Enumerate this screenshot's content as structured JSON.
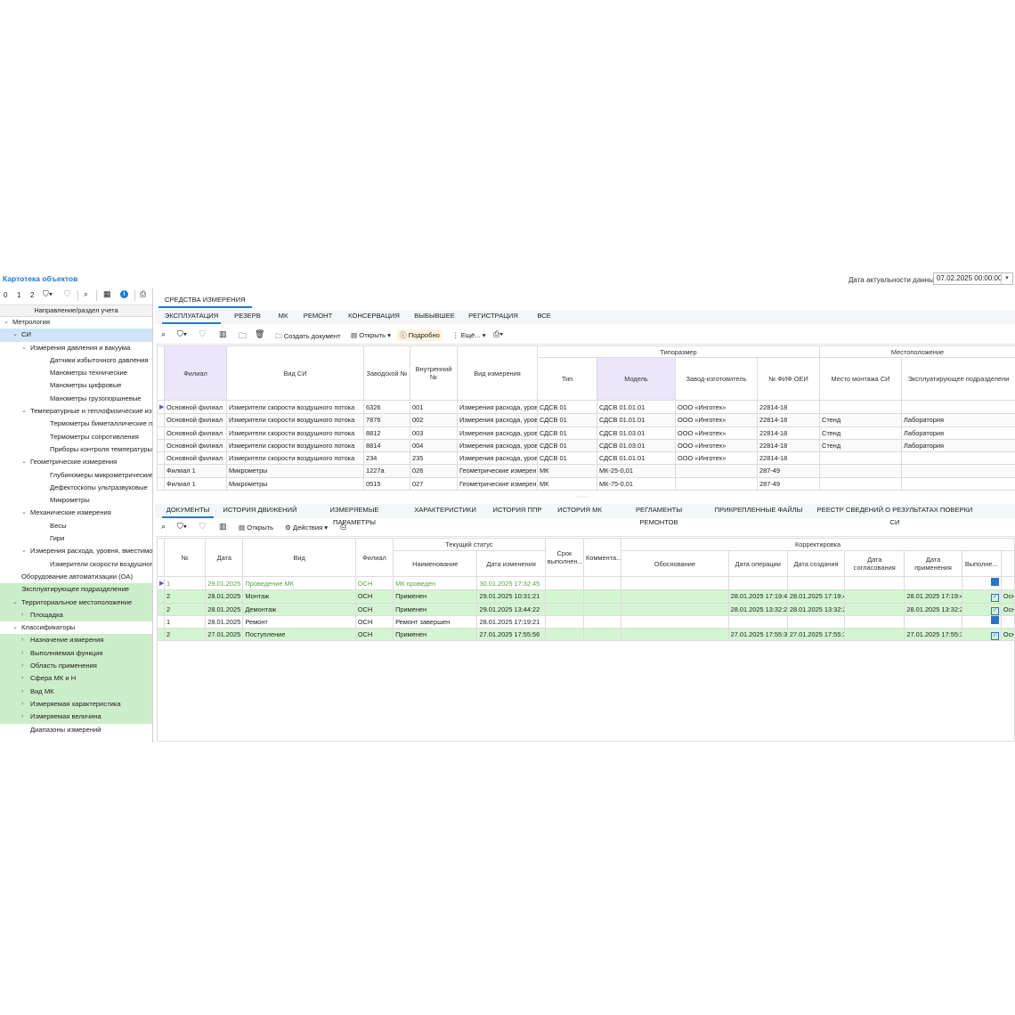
{
  "header": {
    "title": "Картотека объектов",
    "date_label": "Дата актуальности данных",
    "date_value": "07.02.2025 00:00:00"
  },
  "left": {
    "toolbar": {
      "levels": [
        "0",
        "1",
        "2"
      ]
    },
    "column_header": "Направление/раздел учета",
    "tree": [
      {
        "label": "Метрология",
        "level": 0,
        "toggle": "⌄",
        "style": ""
      },
      {
        "label": "СИ",
        "level": 1,
        "toggle": "⌄",
        "style": "sel"
      },
      {
        "label": "Измерения давления и вакуума",
        "level": 2,
        "toggle": "⌄",
        "style": ""
      },
      {
        "label": "Датчики избыточного давления",
        "level": 3,
        "toggle": "",
        "style": ""
      },
      {
        "label": "Манометры технические",
        "level": 3,
        "toggle": "",
        "style": ""
      },
      {
        "label": "Манометры цифровые",
        "level": 3,
        "toggle": "",
        "style": ""
      },
      {
        "label": "Манометры грузопоршневые",
        "level": 3,
        "toggle": "",
        "style": ""
      },
      {
        "label": "Температурные и теплофизические изме",
        "level": 2,
        "toggle": "⌄",
        "style": ""
      },
      {
        "label": "Термометры биметаллические показ",
        "level": 3,
        "toggle": "",
        "style": ""
      },
      {
        "label": "Термометры сопротивления",
        "level": 3,
        "toggle": "",
        "style": ""
      },
      {
        "label": "Приборы контроля температуры",
        "level": 3,
        "toggle": "",
        "style": ""
      },
      {
        "label": "Геометрические измерения",
        "level": 2,
        "toggle": "⌄",
        "style": ""
      },
      {
        "label": "Глубиномеры микрометрические",
        "level": 3,
        "toggle": "",
        "style": ""
      },
      {
        "label": "Дефектоскопы ультразвуковые",
        "level": 3,
        "toggle": "",
        "style": ""
      },
      {
        "label": "Микрометры",
        "level": 3,
        "toggle": "",
        "style": ""
      },
      {
        "label": "Механические измерения",
        "level": 2,
        "toggle": "⌄",
        "style": ""
      },
      {
        "label": "Весы",
        "level": 3,
        "toggle": "",
        "style": ""
      },
      {
        "label": "Гири",
        "level": 3,
        "toggle": "",
        "style": ""
      },
      {
        "label": "Измерения расхода, уровня, вместимост",
        "level": 2,
        "toggle": "⌄",
        "style": ""
      },
      {
        "label": "Измерители скорости воздушного пот",
        "level": 3,
        "toggle": "",
        "style": ""
      },
      {
        "label": "Оборудование автоматизации (ОА)",
        "level": 1,
        "toggle": "",
        "style": ""
      },
      {
        "label": "Эксплуатирующее подразделение",
        "level": 1,
        "toggle": "",
        "style": "green"
      },
      {
        "label": "Территориальное местоположение",
        "level": 1,
        "toggle": "⌄",
        "style": "green"
      },
      {
        "label": "Площадка",
        "level": 2,
        "toggle": "›",
        "style": "green"
      },
      {
        "label": "Классификаторы",
        "level": 1,
        "toggle": "⌄",
        "style": ""
      },
      {
        "label": "Назначение измерения",
        "level": 2,
        "toggle": "›",
        "style": "green"
      },
      {
        "label": "Выполняемая функция",
        "level": 2,
        "toggle": "›",
        "style": "green"
      },
      {
        "label": "Область применения",
        "level": 2,
        "toggle": "›",
        "style": "green"
      },
      {
        "label": "Сфера МК и Н",
        "level": 2,
        "toggle": "›",
        "style": "green"
      },
      {
        "label": "Вид МК",
        "level": 2,
        "toggle": "›",
        "style": "green"
      },
      {
        "label": "Измеряемая характеристика",
        "level": 2,
        "toggle": "›",
        "style": "green"
      },
      {
        "label": "Измеряемая величина",
        "level": 2,
        "toggle": "›",
        "style": "green"
      },
      {
        "label": "Диапазоны измерений",
        "level": 2,
        "toggle": "",
        "style": ""
      }
    ]
  },
  "top_tab": "СРЕДСТВА ИЗМЕРЕНИЯ",
  "main_tabs": [
    "ЭКСПЛУАТАЦИЯ",
    "РЕЗЕРВ",
    "МК",
    "РЕМОНТ",
    "КОНСЕРВАЦИЯ",
    "ВЫБЫВШЕЕ",
    "РЕГИСТРАЦИЯ",
    "ВСЕ"
  ],
  "toolbar1": {
    "create": "Создать документ",
    "open": "Открыть",
    "details": "Подробно",
    "more": "Ещё..."
  },
  "grid1": {
    "group_typesize": "Типоразмер",
    "group_location": "Местоположение",
    "columns": [
      "Филиал",
      "Вид СИ",
      "Заводской №",
      "Внутренний №",
      "Вид измерения",
      "Тип",
      "Модель",
      "Завод-изготовитель",
      "№ ФИФ ОЕИ",
      "Место монтажа СИ",
      "Эксплуатирующее подразделени"
    ],
    "rows": [
      [
        "Основной филиал",
        "Измерители скорости воздушного потока",
        "6326",
        "001",
        "Измерения расхода, уровн",
        "СДСВ 01",
        "СДСВ 01.01.01",
        "ООО «Инготех»",
        "22814-18",
        "",
        ""
      ],
      [
        "Основной филиал",
        "Измерители скорости воздушного потока",
        "7876",
        "002",
        "Измерения расхода, уровн",
        "СДСВ 01",
        "СДСВ 01.01.01",
        "ООО «Инготех»",
        "22814-18",
        "Стенд",
        "Лаборатория"
      ],
      [
        "Основной филиал",
        "Измерители скорости воздушного потока",
        "8812",
        "003",
        "Измерения расхода, уровн",
        "СДСВ 01",
        "СДСВ 01.03.01",
        "ООО «Инготех»",
        "22814-18",
        "Стенд",
        "Лаборатория"
      ],
      [
        "Основной филиал",
        "Измерители скорости воздушного потока",
        "8814",
        "004",
        "Измерения расхода, уровн",
        "СДСВ 01",
        "СДСВ 01.03.01",
        "ООО «Инготех»",
        "22814-18",
        "Стенд",
        "Лаборатория"
      ],
      [
        "Основной филиал",
        "Измерители скорости воздушного потока",
        "234",
        "235",
        "Измерения расхода, уровн",
        "СДСВ 01",
        "СДСВ 01.01.01",
        "ООО «Инготех»",
        "22814-18",
        "",
        ""
      ],
      [
        "Филиал 1",
        "Микрометры",
        "1227a",
        "026",
        "Геометрические измерени",
        "МК",
        "МК-25-0,01",
        "",
        "287-49",
        "",
        ""
      ],
      [
        "Филиал 1",
        "Микрометры",
        "0515",
        "027",
        "Геометрические измерени",
        "МК",
        "МК-75-0,01",
        "",
        "287-49",
        "",
        ""
      ]
    ]
  },
  "bottom_tabs": [
    "ДОКУМЕНТЫ",
    "ИСТОРИЯ ДВИЖЕНИЙ",
    "ИЗМЕРЯЕМЫЕ ПАРАМЕТРЫ",
    "ХАРАКТЕРИСТИКИ",
    "ИСТОРИЯ ППР",
    "ИСТОРИЯ МК",
    "РЕГЛАМЕНТЫ РЕМОНТОВ",
    "ПРИКРЕПЛЕННЫЕ ФАЙЛЫ",
    "РЕЕСТР СВЕДЕНИЙ О РЕЗУЛЬТАТАХ ПОВЕРКИ СИ"
  ],
  "toolbar2": {
    "open": "Открыть",
    "actions": "Действия"
  },
  "grid2": {
    "group_status": "Текущий статус",
    "group_correction": "Корректировка",
    "columns": [
      "№",
      "Дата",
      "Вид",
      "Филиал",
      "Наименование",
      "Дата изменения",
      "Срок выполнен...",
      "Коммента...",
      "Обоснование",
      "Дата операции",
      "Дата создания",
      "Дата согласования",
      "Дата применения",
      "Выполне...",
      ""
    ],
    "rows": [
      {
        "cells": [
          "1",
          "29.01.2025",
          "Проведение МК",
          "ОСН",
          "МК проведен",
          "30.01.2025 17:32:45",
          "",
          "",
          "",
          "",
          "",
          "",
          "",
          "",
          ""
        ],
        "check": "filled",
        "green": false,
        "first": true
      },
      {
        "cells": [
          "2",
          "28.01.2025",
          "Монтаж",
          "ОСН",
          "Применен",
          "29.01.2025 10:31:21",
          "",
          "",
          "",
          "28.01.2025 17:19:4",
          "28.01.2025 17:19:4",
          "",
          "28.01.2025 17:19:4",
          "",
          "Осн"
        ],
        "check": "checked",
        "green": true,
        "first": false
      },
      {
        "cells": [
          "2",
          "28.01.2025",
          "Демонтаж",
          "ОСН",
          "Применен",
          "29.01.2025 13:44:22",
          "",
          "",
          "",
          "28.01.2025 13:32:2",
          "28.01.2025 13:32:2",
          "",
          "28.01.2025 13:32:2",
          "",
          "Осн"
        ],
        "check": "checked",
        "green": true,
        "first": false
      },
      {
        "cells": [
          "1",
          "28.01.2025",
          "Ремонт",
          "ОСН",
          "Ремонт завершен",
          "28.01.2025 17:19:21",
          "",
          "",
          "",
          "",
          "",
          "",
          "",
          "",
          ""
        ],
        "check": "filled",
        "green": false,
        "first": false
      },
      {
        "cells": [
          "2",
          "27.01.2025",
          "Поступление",
          "ОСН",
          "Применен",
          "27.01.2025 17:55:56",
          "",
          "",
          "",
          "27.01.2025 17:55:3",
          "27.01.2025 17:55:3",
          "",
          "27.01.2025 17:55:3",
          "",
          "Осн"
        ],
        "check": "checked",
        "green": true,
        "first": false
      }
    ]
  }
}
